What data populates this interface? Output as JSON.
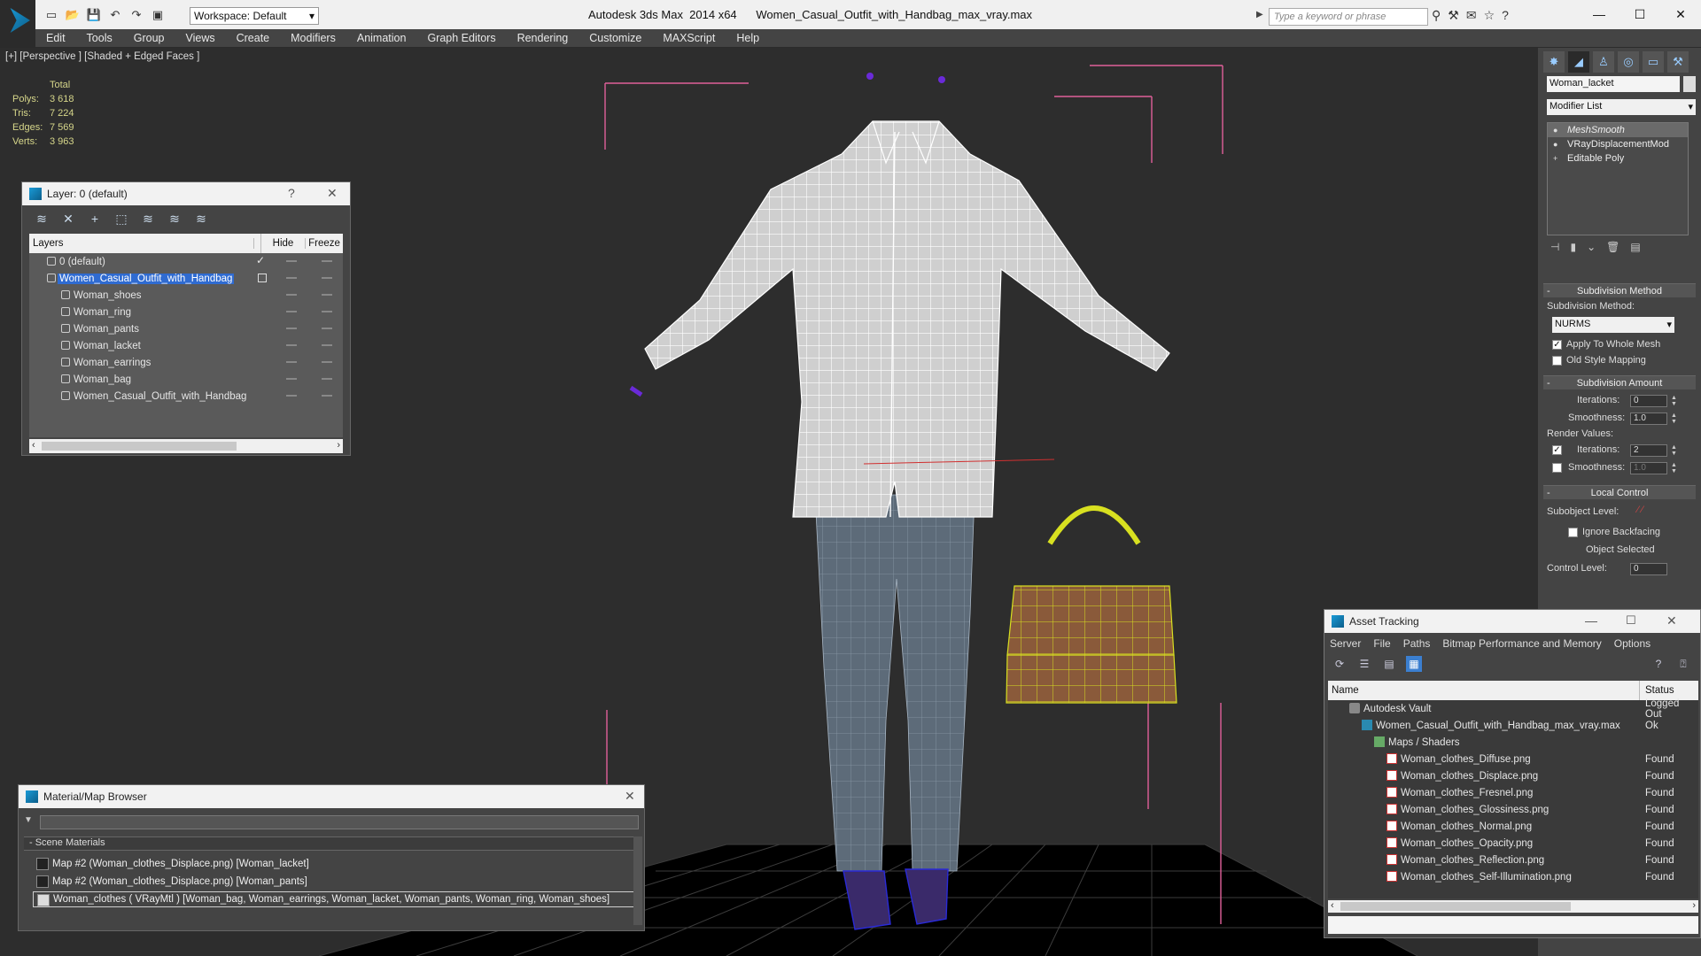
{
  "app": {
    "title_app": "Autodesk 3ds Max  2014 x64",
    "title_file": "Women_Casual_Outfit_with_Handbag_max_vray.max",
    "workspace": "Workspace: Default",
    "search_placeholder": "Type a keyword or phrase"
  },
  "menu": [
    "Edit",
    "Tools",
    "Group",
    "Views",
    "Create",
    "Modifiers",
    "Animation",
    "Graph Editors",
    "Rendering",
    "Customize",
    "MAXScript",
    "Help"
  ],
  "viewport": {
    "label": "[+] [Perspective ] [Shaded + Edged Faces ]",
    "stats_header": "Total",
    "stats": [
      {
        "label": "Polys:",
        "value": "3 618"
      },
      {
        "label": "Tris:",
        "value": "7 224"
      },
      {
        "label": "Edges:",
        "value": "7 569"
      },
      {
        "label": "Verts:",
        "value": "3 963"
      }
    ]
  },
  "layer_dialog": {
    "title": "Layer: 0 (default)",
    "help": "?",
    "col_layers": "Layers",
    "col_hide": "Hide",
    "col_freeze": "Freeze",
    "rows": [
      {
        "name": "0 (default)",
        "indent": 0,
        "check": "✓"
      },
      {
        "name": "Women_Casual_Outfit_with_Handbag",
        "indent": 0,
        "selected": true
      },
      {
        "name": "Woman_shoes",
        "indent": 1
      },
      {
        "name": "Woman_ring",
        "indent": 1
      },
      {
        "name": "Woman_pants",
        "indent": 1
      },
      {
        "name": "Woman_lacket",
        "indent": 1
      },
      {
        "name": "Woman_earrings",
        "indent": 1
      },
      {
        "name": "Woman_bag",
        "indent": 1
      },
      {
        "name": "Women_Casual_Outfit_with_Handbag",
        "indent": 1
      }
    ]
  },
  "material_browser": {
    "title": "Material/Map Browser",
    "section": "- Scene Materials",
    "rows": [
      "Map #2 (Woman_clothes_Displace.png)  [Woman_lacket]",
      "Map #2 (Woman_clothes_Displace.png)  [Woman_pants]",
      "Woman_clothes  ( VRayMtl )  [Woman_bag, Woman_earrings, Woman_lacket, Woman_pants, Woman_ring, Woman_shoes]"
    ]
  },
  "command_panel": {
    "object_name": "Woman_lacket",
    "modifier_list": "Modifier List",
    "stack": [
      {
        "name": "MeshSmooth",
        "selected": true
      },
      {
        "name": "VRayDisplacementMod"
      },
      {
        "name": "Editable Poly"
      }
    ],
    "subdivision_method_hdr": "Subdivision Method",
    "subdivision_method_label": "Subdivision Method:",
    "subdivision_method_value": "NURMS",
    "apply_whole_mesh": "Apply To Whole Mesh",
    "old_style_mapping": "Old Style Mapping",
    "subdivision_amount_hdr": "Subdivision Amount",
    "iterations_label": "Iterations:",
    "iterations_value": "0",
    "smoothness_label": "Smoothness:",
    "smoothness_value": "1.0",
    "render_values_label": "Render Values:",
    "render_iterations_label": "Iterations:",
    "render_iterations_value": "2",
    "render_smoothness_label": "Smoothness:",
    "render_smoothness_value": "1.0",
    "local_control_hdr": "Local Control",
    "subobject_level_label": "Subobject Level:",
    "ignore_backfacing": "Ignore Backfacing",
    "object_selected": "Object Selected",
    "control_level_label": "Control Level:",
    "control_level_value": "0"
  },
  "asset_tracking": {
    "title": "Asset Tracking",
    "menu": [
      "Server",
      "File",
      "Paths",
      "Bitmap Performance and Memory",
      "Options"
    ],
    "col_name": "Name",
    "col_status": "Status",
    "rows": [
      {
        "name": "Autodesk Vault",
        "status": "Logged Out",
        "indent": 1,
        "icon": "vault"
      },
      {
        "name": "Women_Casual_Outfit_with_Handbag_max_vray.max",
        "status": "Ok",
        "indent": 2,
        "icon": "max"
      },
      {
        "name": "Maps / Shaders",
        "status": "",
        "indent": 3,
        "icon": "folder"
      },
      {
        "name": "Woman_clothes_Diffuse.png",
        "status": "Found",
        "indent": 4,
        "icon": "png"
      },
      {
        "name": "Woman_clothes_Displace.png",
        "status": "Found",
        "indent": 4,
        "icon": "png"
      },
      {
        "name": "Woman_clothes_Fresnel.png",
        "status": "Found",
        "indent": 4,
        "icon": "png"
      },
      {
        "name": "Woman_clothes_Glossiness.png",
        "status": "Found",
        "indent": 4,
        "icon": "png"
      },
      {
        "name": "Woman_clothes_Normal.png",
        "status": "Found",
        "indent": 4,
        "icon": "png"
      },
      {
        "name": "Woman_clothes_Opacity.png",
        "status": "Found",
        "indent": 4,
        "icon": "png"
      },
      {
        "name": "Woman_clothes_Reflection.png",
        "status": "Found",
        "indent": 4,
        "icon": "png"
      },
      {
        "name": "Woman_clothes_Self-Illumination.png",
        "status": "Found",
        "indent": 4,
        "icon": "png"
      }
    ]
  },
  "colors": {
    "selection_blue": "#2f6bd1",
    "bbox_pink": "#e0609a",
    "bag_wire": "#d8e020",
    "shoe_blue": "#2a2ad8"
  }
}
